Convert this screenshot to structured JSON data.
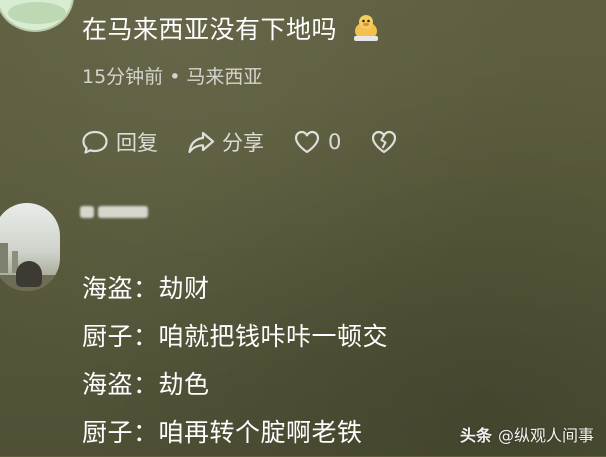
{
  "comment": {
    "text": "在马来西亚没有下地吗",
    "emoji": "duck-emoji",
    "time": "15分钟前",
    "separator": "•",
    "location": "马来西亚"
  },
  "actions": {
    "reply_label": "回复",
    "share_label": "分享",
    "like_count": "0",
    "icons": [
      "comment-bubble-icon",
      "share-arrow-icon",
      "heart-icon",
      "broken-heart-icon"
    ]
  },
  "reply_comment": {
    "lines": [
      "海盗：劫财",
      "厨子：咱就把钱咔咔一顿交",
      "海盗：劫色",
      "厨子：咱再转个腚啊老铁"
    ]
  },
  "watermark": {
    "brand": "头条",
    "account": "@纵观人间事"
  },
  "colors": {
    "background": "#5a5a3c",
    "text": "#ffffff",
    "muted_text": "#c8c8b8"
  }
}
